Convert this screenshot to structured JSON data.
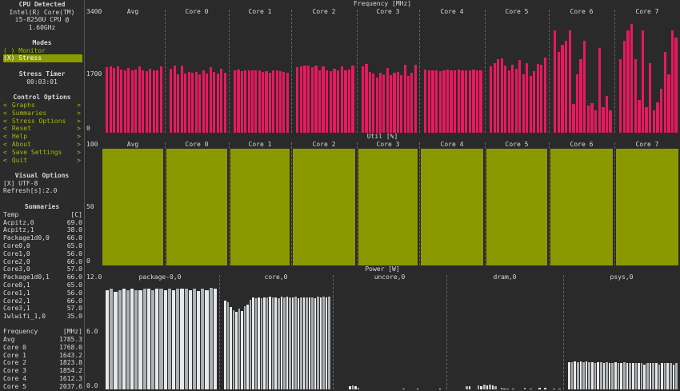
{
  "sidebar": {
    "cpu_title": "CPU Detected",
    "cpu_name": "Intel(R) Core(TM)",
    "cpu_model": "i5-8250U CPU @",
    "cpu_freq": "1.60GHz",
    "modes_title": "Modes",
    "mode_monitor": "( ) Monitor",
    "mode_stress": "(X) Stress",
    "timer_title": "Stress Timer",
    "timer_value": "00:03:01",
    "control_title": "Control Options",
    "control_items": [
      "Graphs",
      "Summaries",
      "Stress Options",
      "Reset",
      "Help",
      "About",
      "Save Settings",
      "Quit"
    ],
    "visual_title": "Visual Options",
    "utf8": "[X] UTF-8",
    "refresh": "Refresh[s]:2.0",
    "summaries_title": "Summaries",
    "temp_header": [
      "Temp",
      "[C]"
    ],
    "temp_rows": [
      [
        "Acpitz,0",
        "69.0"
      ],
      [
        "Acpitz,1",
        "38.0"
      ],
      [
        "Package1d0,0",
        "66.0"
      ],
      [
        "Core0,0",
        "65.0"
      ],
      [
        "Core1,0",
        "56.0"
      ],
      [
        "Core2,0",
        "66.0"
      ],
      [
        "Core3,0",
        "57.0"
      ],
      [
        "Package1d0,1",
        "66.0"
      ],
      [
        "Core0,1",
        "65.0"
      ],
      [
        "Core1,1",
        "56.0"
      ],
      [
        "Core2,1",
        "66.0"
      ],
      [
        "Core3,1",
        "57.0"
      ],
      [
        "Iwlwifi_1,0",
        "35.0"
      ]
    ],
    "freq_header": [
      "Frequency",
      "[MHz]"
    ],
    "freq_rows": [
      [
        "Avg",
        "1785.3"
      ],
      [
        "Core 0",
        "1768.0"
      ],
      [
        "Core 1",
        "1643.2"
      ],
      [
        "Core 2",
        "1823.8"
      ],
      [
        "Core 3",
        "1854.2"
      ],
      [
        "Core 4",
        "1612.3"
      ],
      [
        "Core 5",
        "2037.6"
      ]
    ]
  },
  "freq_panel": {
    "title": "Frequency [MHz]",
    "scale": [
      "3400",
      "1700",
      "0"
    ],
    "columns": [
      "Avg",
      "Core 0",
      "Core 1",
      "Core 2",
      "Core 3",
      "Core 4",
      "Core 5",
      "Core 6",
      "Core 7"
    ],
    "color": "#e8195f"
  },
  "util_panel": {
    "title": "Util [%]",
    "scale": [
      "100",
      "50",
      "0"
    ],
    "columns": [
      "Avg",
      "Core 0",
      "Core 1",
      "Core 2",
      "Core 3",
      "Core 4",
      "Core 5",
      "Core 6",
      "Core 7"
    ],
    "color": "#8b9900"
  },
  "power_panel": {
    "title": "Power [W]",
    "scale": [
      "12.0",
      "6.0",
      "0.0"
    ],
    "columns": [
      "package-0,0",
      "core,0",
      "uncore,0",
      "dram,0",
      "psys,0"
    ],
    "color": "#e8e8e8"
  },
  "chart_data": {
    "type": "bar",
    "freq_series": [
      {
        "name": "Avg",
        "values": [
          1790,
          1800,
          1760,
          1810,
          1720,
          1700,
          1760,
          1690,
          1720,
          1800,
          1700,
          1680,
          1740,
          1690,
          1700,
          1800
        ]
      },
      {
        "name": "Core 0",
        "values": [
          1750,
          1820,
          1600,
          1830,
          1620,
          1650,
          1640,
          1660,
          1600,
          1700,
          1620,
          1780,
          1650,
          1620,
          1750,
          1640
        ]
      },
      {
        "name": "Core 1",
        "values": [
          1700,
          1720,
          1680,
          1700,
          1690,
          1700,
          1700,
          1690,
          1660,
          1680,
          1640,
          1690,
          1700,
          1680,
          1650,
          1630
        ]
      },
      {
        "name": "Core 2",
        "values": [
          1780,
          1800,
          1820,
          1830,
          1780,
          1840,
          1700,
          1800,
          1690,
          1680,
          1750,
          1700,
          1800,
          1690,
          1720,
          1840
        ]
      },
      {
        "name": "Core 3",
        "values": [
          1800,
          1880,
          1660,
          1620,
          1500,
          1630,
          1600,
          1770,
          1560,
          1640,
          1650,
          1580,
          1860,
          1540,
          1640,
          1860
        ]
      },
      {
        "name": "Core 4",
        "values": [
          1720,
          1700,
          1690,
          1710,
          1680,
          1700,
          1720,
          1710,
          1700,
          1720,
          1690,
          1710,
          1700,
          1720,
          1690,
          1710
        ]
      },
      {
        "name": "Core 5",
        "values": [
          1800,
          1900,
          2000,
          2030,
          1820,
          1690,
          1860,
          1740,
          1980,
          1600,
          1900,
          1550,
          1680,
          1870,
          1860,
          2040
        ]
      },
      {
        "name": "Core 6",
        "values": [
          2800,
          2200,
          2400,
          2500,
          2800,
          780,
          1600,
          2000,
          2500,
          750,
          800,
          600,
          2300,
          700,
          1000,
          600
        ]
      },
      {
        "name": "Core 7",
        "values": [
          2000,
          2500,
          2800,
          2960,
          2000,
          900,
          2780,
          700,
          1900,
          600,
          820,
          1200,
          2200,
          1600,
          2800,
          2600
        ]
      }
    ],
    "util_series": [
      {
        "name": "Avg",
        "values": [
          100
        ]
      },
      {
        "name": "Core 0",
        "values": [
          100
        ]
      },
      {
        "name": "Core 1",
        "values": [
          100
        ]
      },
      {
        "name": "Core 2",
        "values": [
          100
        ]
      },
      {
        "name": "Core 3",
        "values": [
          100
        ]
      },
      {
        "name": "Core 4",
        "values": [
          100
        ]
      },
      {
        "name": "Core 5",
        "values": [
          100
        ]
      },
      {
        "name": "Core 6",
        "values": [
          100
        ]
      },
      {
        "name": "Core 7",
        "values": [
          100
        ]
      }
    ],
    "power_series": [
      {
        "name": "package-0,0",
        "values": [
          10.3,
          10.4,
          10.1,
          10.3,
          10.4,
          10.3,
          10.4,
          10.3,
          10.3,
          10.4,
          10.4,
          10.3,
          10.4,
          10.4,
          10.3,
          10.4,
          10.3,
          10.4,
          10.4,
          10.4,
          10.3,
          10.4,
          10.2,
          10.4,
          10.3,
          10.5,
          10.4
        ]
      },
      {
        "name": "core,0",
        "values": [
          9.2,
          9.0,
          8.5,
          8.2,
          8.0,
          8.4,
          8.1,
          8.6,
          8.8,
          9.3,
          9.5,
          9.4,
          9.5,
          9.4,
          9.5,
          9.5,
          9.6,
          9.5,
          9.5,
          9.4,
          9.6,
          9.5,
          9.6,
          9.5,
          9.5,
          9.6,
          9.4,
          9.5,
          9.5,
          9.5,
          9.5,
          9.5,
          9.4,
          9.6,
          9.5,
          9.6,
          9.5,
          9.6
        ]
      },
      {
        "name": "uncore,0",
        "values": [
          0,
          0,
          0,
          0,
          0.3,
          0.4,
          0.3,
          0.2,
          0,
          0,
          0,
          0,
          0,
          0,
          0,
          0,
          0,
          0,
          0,
          0,
          0,
          0,
          0,
          0.1,
          0,
          0,
          0,
          0,
          0.1,
          0,
          0,
          0,
          0,
          0,
          0,
          0,
          0.1,
          0
        ]
      },
      {
        "name": "dram,0",
        "values": [
          0,
          0,
          0,
          0,
          0,
          0.3,
          0.3,
          0,
          0,
          0.4,
          0.3,
          0.5,
          0.4,
          0.5,
          0.4,
          0.3,
          0,
          0.2,
          0.1,
          0.1,
          0,
          0.1,
          0,
          0,
          0,
          0.2,
          0,
          0.1,
          0,
          0,
          0.2,
          0,
          0.2,
          0,
          0,
          0.1,
          0,
          0.1
        ]
      },
      {
        "name": "psys,0",
        "values": [
          2.8,
          2.8,
          2.9,
          2.8,
          2.9,
          2.8,
          2.9,
          2.8,
          2.8,
          2.7,
          2.8,
          2.8,
          2.7,
          2.8,
          2.7,
          2.7,
          2.8,
          2.7,
          2.7,
          2.8,
          2.7,
          2.7,
          2.7,
          2.7,
          2.7,
          2.7,
          2.6,
          2.7,
          2.7,
          2.7,
          2.7,
          2.6,
          2.7,
          2.7,
          2.7,
          2.7,
          2.6,
          2.7
        ]
      }
    ]
  }
}
